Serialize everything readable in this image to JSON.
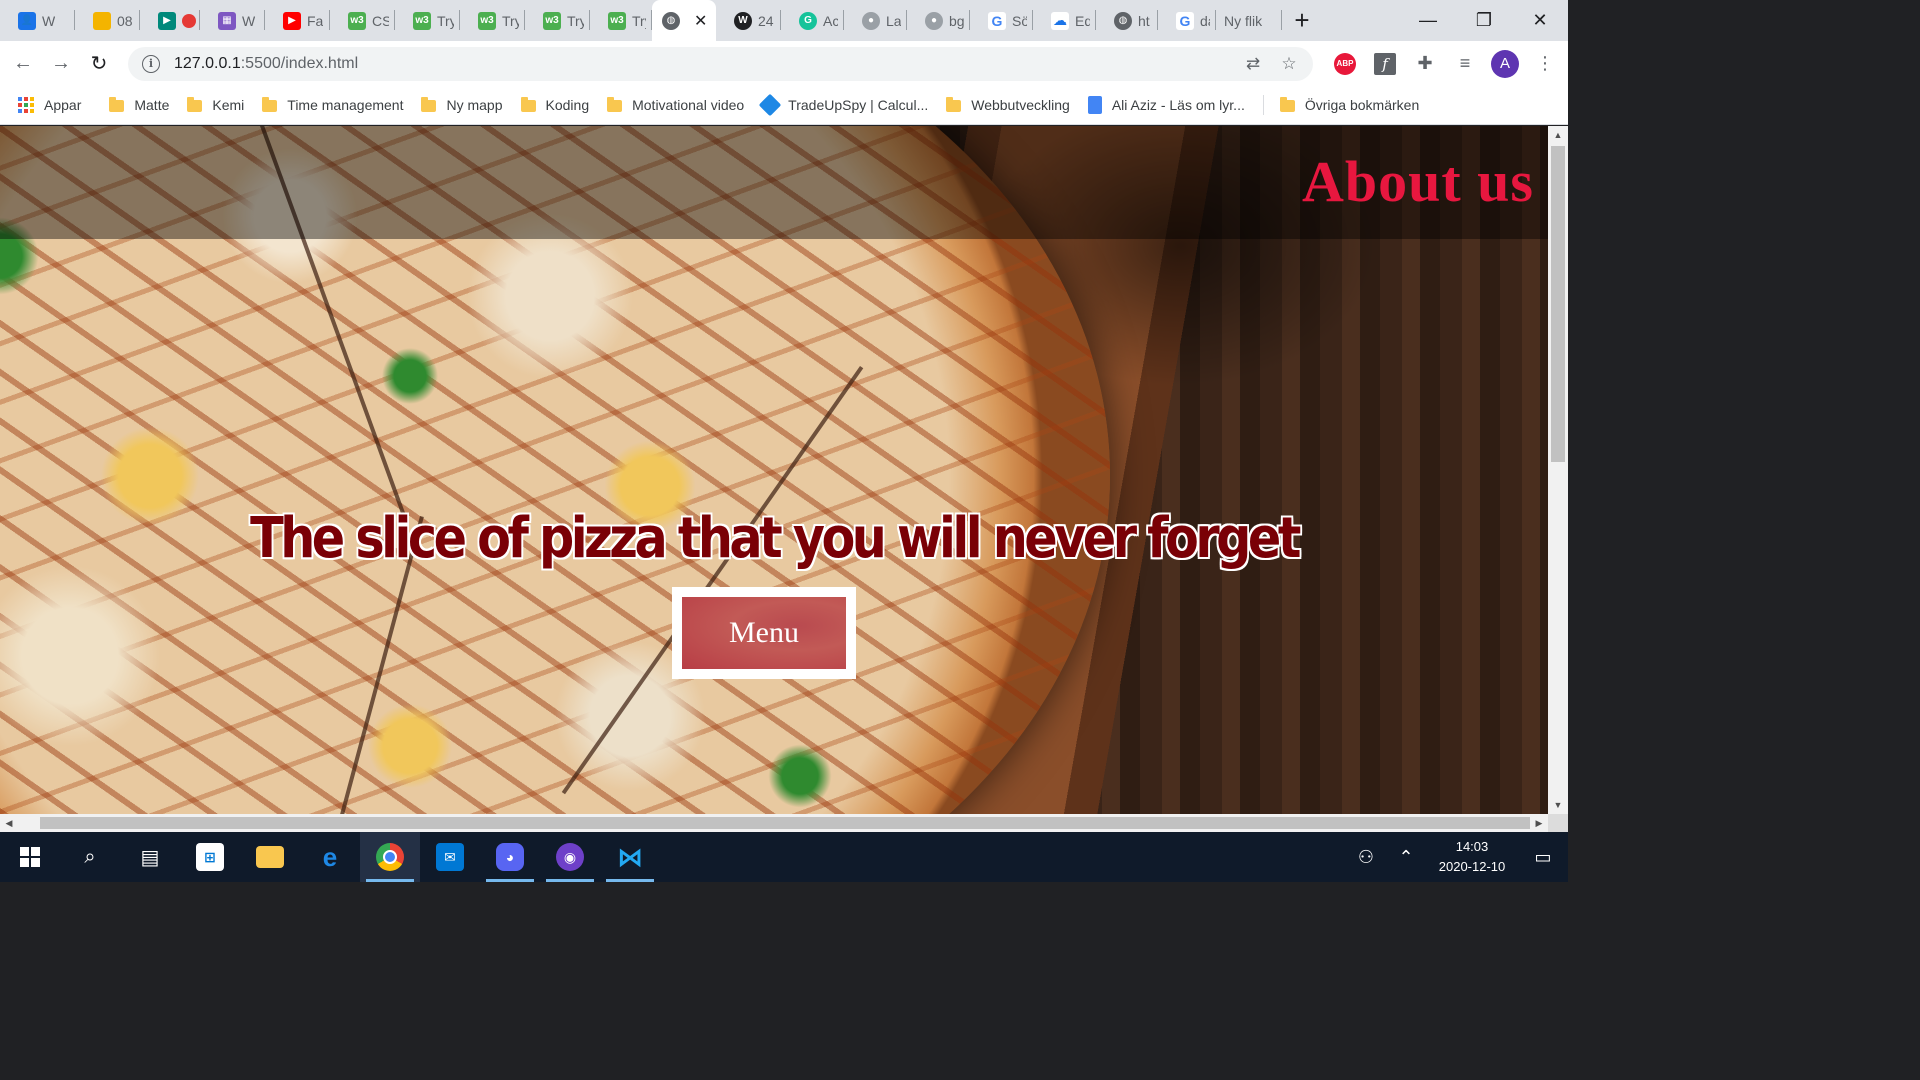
{
  "browser": {
    "tabs": [
      {
        "label": "W",
        "icon": "google-contacts-icon",
        "color": "#1a73e8"
      },
      {
        "label": "08",
        "icon": "google-slides-icon",
        "color": "#f4b400"
      },
      {
        "label": "",
        "icon": "google-meet-icon",
        "color": "#00897b"
      },
      {
        "label": "W",
        "icon": "clapperboard-icon",
        "color": "#7e57c2"
      },
      {
        "label": "Fa",
        "icon": "youtube-icon",
        "color": "#ff0000"
      },
      {
        "label": "CS",
        "icon": "w3schools-icon",
        "color": "#4caf50"
      },
      {
        "label": "Try",
        "icon": "w3schools-icon",
        "color": "#4caf50"
      },
      {
        "label": "Try",
        "icon": "w3schools-icon",
        "color": "#4caf50"
      },
      {
        "label": "Try",
        "icon": "w3schools-icon",
        "color": "#4caf50"
      },
      {
        "label": "Try",
        "icon": "w3schools-icon",
        "color": "#4caf50"
      },
      {
        "label": "",
        "icon": "globe-icon",
        "color": "#5f6368",
        "active": true
      },
      {
        "label": "24",
        "icon": "wordpress-icon",
        "color": "#202124"
      },
      {
        "label": "Ac",
        "icon": "grammarly-icon",
        "color": "#15c39a"
      },
      {
        "label": "La",
        "icon": "record-icon",
        "color": "#9aa0a6"
      },
      {
        "label": "bg",
        "icon": "record-icon",
        "color": "#9aa0a6"
      },
      {
        "label": "Sö",
        "icon": "google-icon",
        "color": "#4285f4"
      },
      {
        "label": "Ed",
        "icon": "cloud-icon",
        "color": "#1a73e8"
      },
      {
        "label": "ht",
        "icon": "globe-icon",
        "color": "#5f6368"
      },
      {
        "label": "da",
        "icon": "google-icon",
        "color": "#4285f4"
      },
      {
        "label": "Ny flik",
        "icon": "",
        "color": "#5f6368"
      }
    ],
    "new_tab_symbol": "+",
    "window_controls": {
      "minimize": "—",
      "restore": "❐",
      "close": "✕"
    },
    "url_host": "127.0.0.1",
    "url_rest": ":5500/index.html",
    "avatar_letter": "A",
    "bookmarks": [
      {
        "label": "Appar",
        "type": "apps"
      },
      {
        "label": "Matte",
        "type": "folder"
      },
      {
        "label": "Kemi",
        "type": "folder"
      },
      {
        "label": "Time management",
        "type": "folder"
      },
      {
        "label": "Ny mapp",
        "type": "folder"
      },
      {
        "label": "Koding",
        "type": "folder"
      },
      {
        "label": "Motivational video",
        "type": "folder"
      },
      {
        "label": "TradeUpSpy | Calcul...",
        "type": "site"
      },
      {
        "label": "Webbutveckling",
        "type": "folder"
      },
      {
        "label": "Ali Aziz - Läs om lyr...",
        "type": "doc"
      }
    ],
    "other_bookmarks": "Övriga bokmärken"
  },
  "page": {
    "about_link": "About us",
    "hero_title": "The slice of pizza that you will never forget",
    "menu_button": "Menu",
    "colors": {
      "about": "#e8173f",
      "hero": "#7a0006",
      "button": "#b94a4f"
    }
  },
  "taskbar": {
    "apps": [
      "start",
      "search",
      "task-view",
      "microsoft-store",
      "file-explorer",
      "edge",
      "chrome",
      "mail",
      "discord",
      "github-desktop",
      "vscode"
    ],
    "time": "14:03",
    "date": "2020-12-10"
  }
}
